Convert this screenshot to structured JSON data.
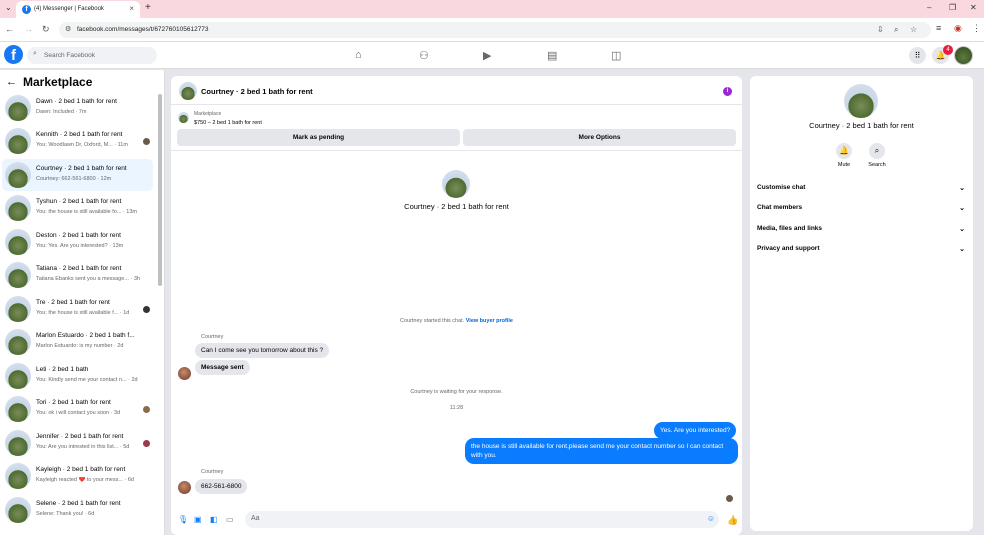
{
  "browser": {
    "tab_title": "(4) Messenger | Facebook",
    "url": "facebook.com/messages/t/6727601056127​73"
  },
  "fb": {
    "search_placeholder": "Search Facebook",
    "notif_count": "4"
  },
  "sidebar": {
    "title": "Marketplace",
    "conversations": [
      {
        "name": "Dawn · 2 bed 1 bath for rent",
        "snippet": "Dawn: Included · 7m"
      },
      {
        "name": "Kennith · 2 bed 1 bath for rent",
        "snippet": "You: Woodlawn Dr, Oxford, M... · 11m"
      },
      {
        "name": "Courtney · 2 bed 1 bath for rent",
        "snippet": "Courtney: 662-561-6800 · 12m"
      },
      {
        "name": "Tyshun · 2 bed 1 bath for rent",
        "snippet": "You: the house is still available fo... · 13m"
      },
      {
        "name": "Deston · 2 bed 1 bath for rent",
        "snippet": "You: Yes. Are you interested? · 13m"
      },
      {
        "name": "Tatiana · 2 bed 1 bath for rent",
        "snippet": "Tatiana Ebanks sent you a message... · 3h"
      },
      {
        "name": "Tre · 2 bed 1 bath for rent",
        "snippet": "You: the house is still available f... · 1d"
      },
      {
        "name": "Marlon Estuardo · 2 bed 1 bath f...",
        "snippet": "Marlon Estuardo: is my number · 2d"
      },
      {
        "name": "Leti · 2 bed 1 bath",
        "snippet": "You: Kindly send me your contact n... · 2d"
      },
      {
        "name": "Tori · 2 bed 1 bath for rent",
        "snippet": "You: ok i will contact you soon · 3d"
      },
      {
        "name": "Jennifer · 2 bed 1 bath for rent",
        "snippet": "You: Are you intrested in this list... · 5d"
      },
      {
        "name": "Kayleigh · 2 bed 1 bath for rent",
        "snippet": "Kayleigh reacted ❤️ to your mess... · 6d"
      },
      {
        "name": "Selene · 2 bed 1 bath for rent",
        "snippet": "Selene: Thank you! · 6d"
      }
    ]
  },
  "chat": {
    "header_title": "Courtney · 2 bed 1 bath for rent",
    "mp_label": "Marketplace",
    "mp_price": "$750 – 2 bed 1 bath for rent",
    "btn_pending": "Mark as pending",
    "btn_more": "More Options",
    "intro_name": "Courtney · 2 bed 1 bath for rent",
    "started_text": "Courtney started this chat.",
    "view_profile": "View buyer profile",
    "sender1": "Courtney",
    "msg1": "Can I come see you tomorrow about this ?",
    "msg2": "Message sent",
    "waiting": "Courtney is waiting for your response.",
    "time": "11:28",
    "out1": "Yes. Are you interested?",
    "out2": "the house is still available for rent,please send me your contact number so I can contact with you.",
    "sender2": "Courtney",
    "msg3": "662-561-6800",
    "composer_placeholder": "Aa"
  },
  "panel": {
    "name": "Courtney · 2 bed 1 bath for rent",
    "mute": "Mute",
    "search": "Search",
    "rows": [
      "Customise chat",
      "Chat members",
      "Media, files and links",
      "Privacy and support"
    ]
  }
}
